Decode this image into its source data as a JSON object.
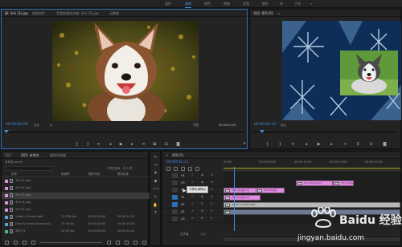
{
  "menu": {
    "items": [
      {
        "label": "组件",
        "active": false
      },
      {
        "label": "编辑",
        "active": true
      },
      {
        "label": "颜色",
        "active": false
      },
      {
        "label": "效果",
        "active": false
      },
      {
        "label": "音频",
        "active": false
      },
      {
        "label": "图形",
        "active": false
      },
      {
        "label": "库",
        "active": false
      },
      {
        "label": "工作",
        "active": false
      }
    ],
    "overflow": "»"
  },
  "source_monitor": {
    "tabs": [
      "源: 3mi (3).jpg",
      "效果控件",
      "音频剪辑混合器: 3mi (3).jpg",
      "元数据"
    ],
    "timecode": "00:00:00:00",
    "fit": "适合",
    "zoom": "完整",
    "duration": "00:00:05:00"
  },
  "program_monitor": {
    "tab": "节目: 序列 01",
    "timecode": "00:00:01:11",
    "fit": "适合"
  },
  "project_panel": {
    "tabs": [
      "项目",
      "项目: 未命名",
      "媒体浏览器"
    ],
    "project_file": "未命名.prproj",
    "item_count": "1 项已选择，共 9 项",
    "columns": [
      "名称",
      "帧速率",
      "媒体开始",
      "媒体结束"
    ],
    "items": [
      {
        "name": "3mi (1).jpg",
        "rate": "",
        "start": "",
        "end": "",
        "color": "#e08ee0"
      },
      {
        "name": "3mi (2).jpg",
        "rate": "",
        "start": "",
        "end": "",
        "color": "#e08ee0"
      },
      {
        "name": "3mi (3).jpg",
        "rate": "",
        "start": "",
        "end": "",
        "color": "#e08ee0"
      },
      {
        "name": "3mi (4).jpg",
        "rate": "",
        "start": "",
        "end": "",
        "color": "#e08ee0"
      },
      {
        "name": "3mi (5).jpg",
        "rate": "",
        "start": "",
        "end": "",
        "color": "#e08ee0"
      },
      {
        "name": "Under A Snow Light",
        "rate": "23.976 fps",
        "start": "00:00:00:00",
        "end": "00:00:19:23",
        "color": "#5aa0d8"
      },
      {
        "name": "Flow to Snow Space.mp4",
        "rate": "25.00 fps",
        "start": "00:00:00:00",
        "end": "00:00:19:23",
        "color": "#5aa0d8"
      },
      {
        "name": "序列 01",
        "rate": "25.00 fps",
        "start": "00:00:00:00",
        "end": "00:00:24:24",
        "color": "#3fbf7f"
      }
    ]
  },
  "timeline": {
    "tab": "序列 01",
    "timecode": "00:00:01:11",
    "ruler": [
      "00:00",
      "00:00:05:00",
      "00:00:10:00",
      "00:00:15:00",
      "00:00:20:00"
    ],
    "tracks": [
      {
        "name": "V4"
      },
      {
        "name": "V3"
      },
      {
        "name": "V2"
      },
      {
        "name": "V1"
      },
      {
        "name": "A1"
      },
      {
        "name": "A2"
      },
      {
        "name": "A3"
      }
    ],
    "tooltip": "切换轨道输出",
    "master": "主声道",
    "master_value": "0.0",
    "clips": [
      {
        "track": 1,
        "label": "3mi (4).jpg [V]",
        "color": "pink"
      },
      {
        "track": 1,
        "label": "3mi (5).jpg",
        "color": "pink"
      },
      {
        "track": 2,
        "label": "3mi (3).jpg [V]",
        "color": "pink"
      },
      {
        "track": 2,
        "label": "3mi (2).jpg",
        "color": "pink"
      },
      {
        "track": 3,
        "label": "3mi (1).jpg",
        "color": "pink"
      },
      {
        "track": 3,
        "label": "3mi (1).jpg [V]",
        "color": "pink"
      },
      {
        "track": 4,
        "label": "Under A Snow Light",
        "color": "grey"
      },
      {
        "track": 5,
        "label": "",
        "color": "dark"
      }
    ]
  },
  "watermark": {
    "brand": "Baidu 经验",
    "url": "jingyan.baidu.com"
  },
  "colors": {
    "accent": "#3f8fdc",
    "panel": "#232323",
    "clip_pink": "#e08ee0"
  }
}
